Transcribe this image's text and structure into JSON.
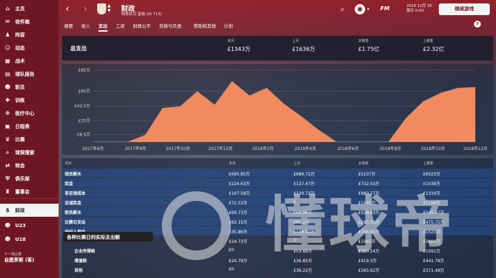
{
  "sidebar": {
    "items": [
      {
        "label": "主页",
        "icon": "home-icon",
        "glyph": "⌂"
      },
      {
        "label": "收件箱",
        "icon": "inbox-icon",
        "glyph": "✉"
      },
      {
        "label": "阵容",
        "icon": "squad-icon",
        "glyph": "♟"
      },
      {
        "label": "动态",
        "icon": "dynamics-icon",
        "glyph": "☺"
      },
      {
        "label": "战术",
        "icon": "tactics-icon",
        "glyph": "▦"
      },
      {
        "label": "球队报告",
        "icon": "report-icon",
        "glyph": "▤"
      },
      {
        "label": "职员",
        "icon": "staff-icon",
        "glyph": "☻"
      },
      {
        "label": "训练",
        "icon": "training-icon",
        "glyph": "✚"
      },
      {
        "label": "医疗中心",
        "icon": "medical-icon",
        "glyph": "✙"
      },
      {
        "label": "日程表",
        "icon": "calendar-icon",
        "glyph": "▣"
      },
      {
        "label": "比赛",
        "icon": "competition-icon",
        "glyph": "♛"
      },
      {
        "label": "球探搜索",
        "icon": "scouting-icon",
        "glyph": "⌕"
      },
      {
        "label": "转会",
        "icon": "transfers-icon",
        "glyph": "⇄"
      },
      {
        "label": "俱乐部",
        "icon": "club-icon",
        "glyph": "⛨"
      },
      {
        "label": "董事会",
        "icon": "board-icon",
        "glyph": "♜"
      },
      {
        "label": "财政",
        "icon": "finances-icon",
        "glyph": "$"
      },
      {
        "label": "U23",
        "icon": "u23-icon",
        "glyph": "☻"
      },
      {
        "label": "U18",
        "icon": "u18-icon",
        "glyph": "☻"
      }
    ],
    "active_index": 15,
    "next_match_label": "下一场比赛",
    "next_match_team": "自愿茅斯 (客)"
  },
  "header": {
    "title": "财政",
    "subtitle": "财政状况 富裕 (ID 713)",
    "date_line1": "2018 12月 30",
    "date_line2": "周日 0:00",
    "fm_logo": "FM",
    "continue_label": "继续游戏"
  },
  "tabs": [
    "摘要",
    "收入",
    "支出",
    "工资",
    "财政公平",
    "贷款与负债",
    "赞助和其他",
    "计划"
  ],
  "active_tab": 2,
  "summary": {
    "label": "总支出",
    "columns": [
      {
        "header": "本月",
        "value": "£1343万"
      },
      {
        "header": "上月",
        "value": "£1636万"
      },
      {
        "header": "本赛季",
        "value": "£1.75亿"
      },
      {
        "header": "上赛季",
        "value": "£2.32亿"
      }
    ]
  },
  "chart_data": {
    "type": "area",
    "y_ticks": [
      "£8.5万",
      "£25万",
      "£42.5万",
      "£60万",
      "£85万"
    ],
    "y_tick_values": [
      8.5,
      25,
      42.5,
      60,
      85
    ],
    "ylim": [
      0,
      85
    ],
    "x_tick_labels": [
      "2017年6月",
      "2017年8月",
      "2017年10月",
      "2017年12月",
      "2018年2月",
      "2018年4月",
      "2018年6月",
      "2018年8月",
      "2018年10月",
      "2018年12月"
    ],
    "unit": "万",
    "series": [
      {
        "color": "#f28a5e",
        "values": [
          0,
          0,
          0,
          8,
          40,
          42,
          60,
          44,
          72,
          55,
          64,
          45,
          30,
          14,
          0,
          0,
          null,
          0,
          28,
          48,
          58,
          64,
          65
        ]
      }
    ]
  },
  "table": {
    "headers": [
      "项目",
      "本月",
      "上月",
      "本赛季",
      "上赛季"
    ],
    "rows": [
      {
        "name": "球员薪水",
        "cols": [
          "£695.85万",
          "£686.72万",
          "£5107万",
          "£6523万"
        ],
        "indent": false
      },
      {
        "name": "奖金",
        "cols": [
          "£224.63万",
          "£137.47万",
          "£732.03万",
          "£1038万"
        ],
        "indent": false
      },
      {
        "name": "非足球成本",
        "cols": [
          "£107.58万",
          "£130.72万",
          "£983.77万",
          "£1334万"
        ],
        "indent": false
      },
      {
        "name": "忠诚奖金",
        "cols": [
          "£72.53万",
          "£",
          "£1143万",
          "£1156万"
        ],
        "indent": false
      },
      {
        "name": "职员薪水",
        "cols": [
          "£69.73万",
          "£68.94万",
          "£528.83万",
          "£545.67万"
        ],
        "indent": false
      },
      {
        "name": "比赛日支出",
        "cols": [
          "£62.15万",
          "£65.2万",
          "£285.39万",
          "£475.75万"
        ],
        "indent": false
      },
      {
        "name": "经纪人佣金",
        "cols": [
          "£35.86万",
          "£106.02万",
          "£758.89万",
          "£1523万"
        ],
        "indent": false
      },
      {
        "name": "",
        "cols": [
          "£24.73万",
          "£",
          "£1045万",
          "£1904万"
        ],
        "indent": false
      },
      {
        "name": "企业所得税",
        "cols": [
          "£0",
          "£53.89万",
          "£380.24万",
          "£1091万"
        ],
        "indent": true
      },
      {
        "name": "增值税",
        "cols": [
          "£24.79万",
          "£36.85万",
          "£419.3万",
          "£441.78万"
        ],
        "indent": true
      },
      {
        "name": "其他",
        "cols": [
          "£0",
          "£36.22万",
          "£265.62万",
          "£371.48万"
        ],
        "indent": true
      }
    ],
    "highlight_rows": [
      0,
      1,
      2,
      3,
      4,
      5,
      6
    ]
  },
  "tooltip": "各种比赛日的实际支出额",
  "watermark": "懂球帝"
}
